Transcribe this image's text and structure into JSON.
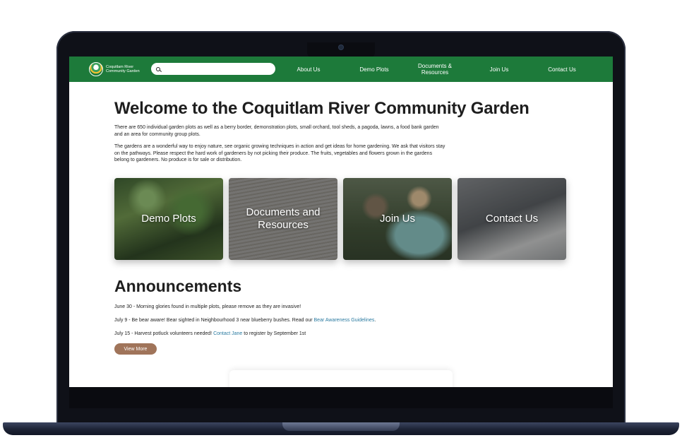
{
  "site": {
    "logo_line1": "Coquitlam River",
    "logo_line2": "Community Garden"
  },
  "search": {
    "placeholder": "",
    "value": ""
  },
  "nav": {
    "about": "About Us",
    "demo": "Demo Plots",
    "docs_line1": "Documents &",
    "docs_line2": "Resources",
    "join": "Join Us",
    "contact": "Contact Us"
  },
  "main": {
    "title": "Welcome to the Coquitlam River Community Garden",
    "intro_1": "There are 650 individual garden plots as well as a berry border, demonstration plots, small orchard, tool sheds, a pagoda, lawns, a food bank garden and an area for community group plots.",
    "intro_2": "The gardens are a wonderful way to enjoy nature, see organic growing techniques in action and get ideas for home gardening. We ask that visitors stay on the pathways. Please respect the hard work of gardeners by not picking their produce. The fruits, vegetables and flowers grown in the gardens belong to gardeners. No produce is for sale or distribution."
  },
  "cards": {
    "demo": "Demo Plots",
    "docs": "Documents and Resources",
    "join": "Join Us",
    "contact": "Contact Us"
  },
  "announcements": {
    "title": "Announcements",
    "item1": "June 30 - Morning glories found in multiple plots, please remove as they are invasive!",
    "item2_text": "July 9 - Be bear aware! Bear sighted in Neighbourhood 3 near blueberry bushes. Read our ",
    "item2_link": "Bear Awareness Guidelines",
    "item2_end": ".",
    "item3_text": "July 15 - Harvest potluck volunteers needed! ",
    "item3_link": "Contact Jane",
    "item3_end": " to register by September 1st",
    "view_more": "View More"
  },
  "colors": {
    "nav_green": "#1d7a3a",
    "button_brown": "#a0745a",
    "link_blue": "#2a7aa0"
  }
}
